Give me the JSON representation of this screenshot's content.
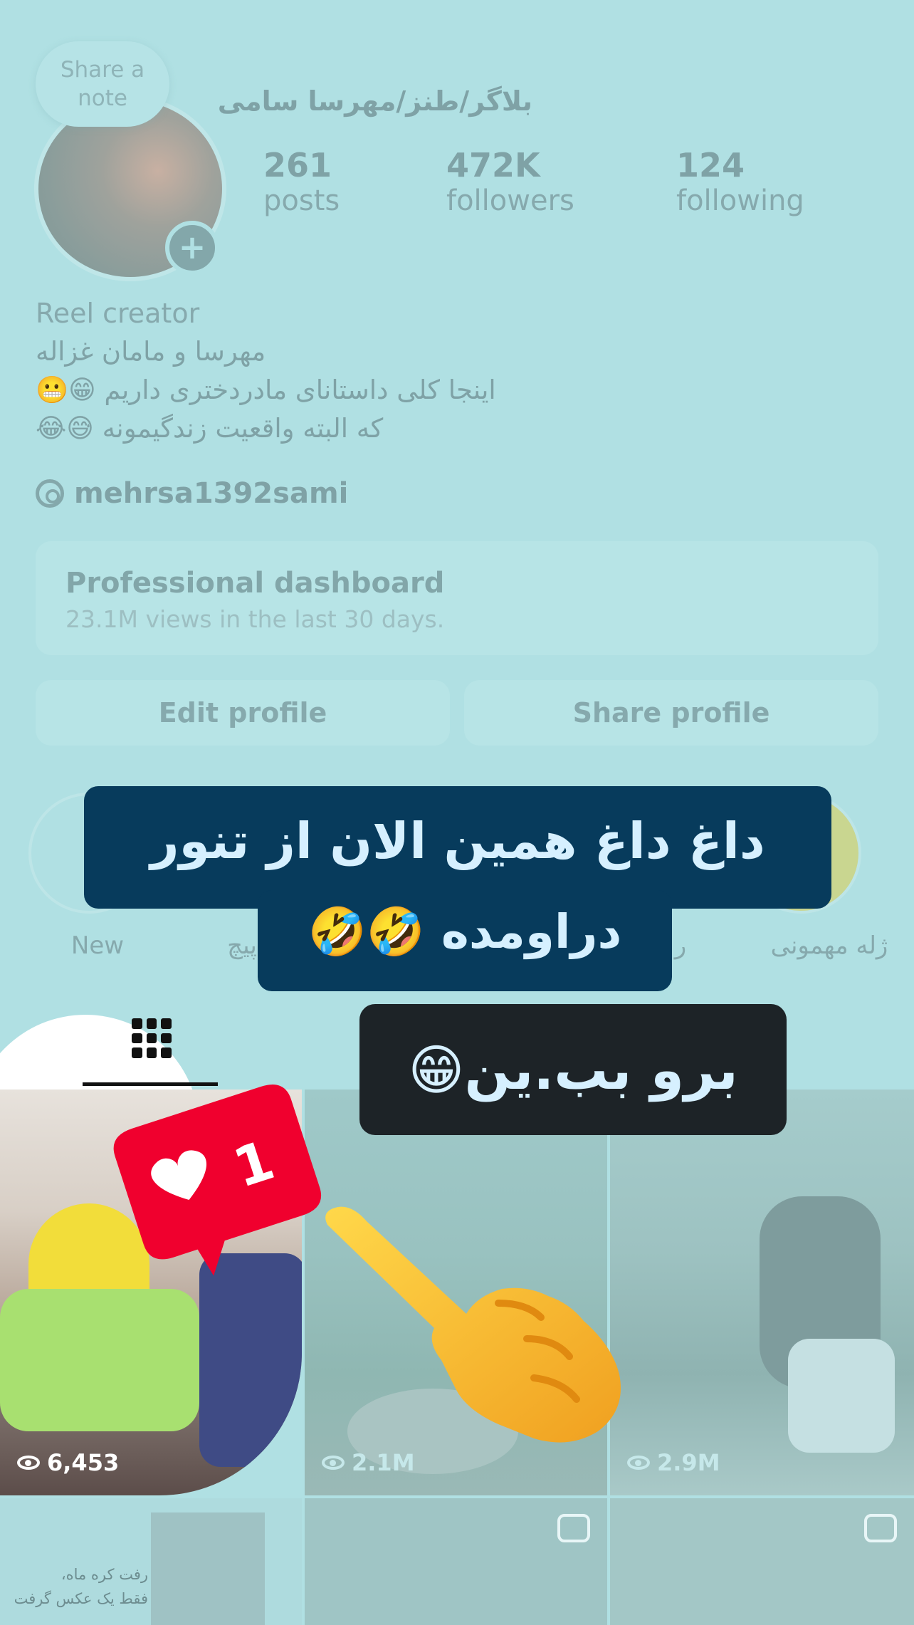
{
  "profile": {
    "note_placeholder": "Share a\nnote",
    "name": "بلاگر/طنز/مهرسا سامی",
    "stats": [
      {
        "value": "261",
        "label": "posts"
      },
      {
        "value": "472K",
        "label": "followers"
      },
      {
        "value": "124",
        "label": "following"
      }
    ],
    "category": "Reel creator",
    "bio_lines": [
      "مهرسا و مامان غزاله",
      "اینجا کلی داستانای مادردختری داریم 😁😬",
      "که البته واقعیت زندگیمونه 😅😂"
    ],
    "threads_handle": "mehrsa1392sami"
  },
  "dashboard": {
    "title": "Professional dashboard",
    "subtitle": "23.1M views in the last 30 days."
  },
  "buttons": {
    "edit": "Edit profile",
    "share": "Share profile"
  },
  "highlights": {
    "new_label": "New",
    "item2_label": "پیچ",
    "item3_label": "ر",
    "item4_label": "ژله مهمونی"
  },
  "overlay": {
    "caption_line1": "داغ داغ همین الان از تنور",
    "caption_line2": "دراومده 🤣🤣",
    "cta": "برو بب.ین😁",
    "like_count": "1"
  },
  "grid": {
    "tiles": [
      {
        "views": "6,453"
      },
      {
        "views": "2.1M"
      },
      {
        "views": "2.9M"
      }
    ],
    "bottom_left_text_line1": "رفت کره ماه،",
    "bottom_left_text_line2": "فقط یک عکس گرفت"
  },
  "colors": {
    "overlay_tint": "#b0e0e3",
    "caption_bg": "#073b5c",
    "caption_text": "#d6f0ff",
    "cta_bg": "#1d2327",
    "like_red": "#f0002e"
  }
}
